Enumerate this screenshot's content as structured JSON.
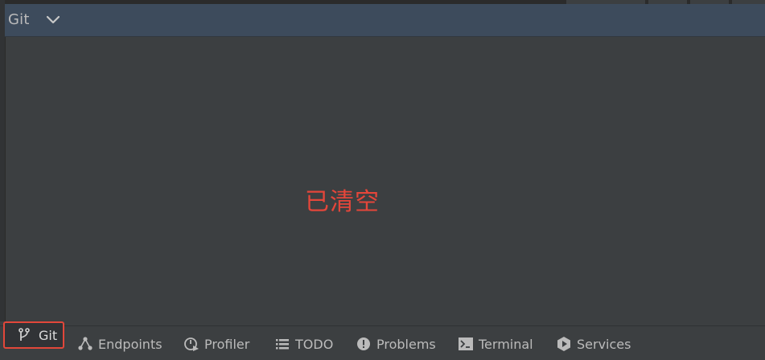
{
  "panel": {
    "title": "Git",
    "message": "已清空"
  },
  "toolwindows": [
    {
      "label": "Git",
      "icon": "git-branch-icon"
    },
    {
      "label": "Endpoints",
      "icon": "endpoints-icon"
    },
    {
      "label": "Profiler",
      "icon": "profiler-icon"
    },
    {
      "label": "TODO",
      "icon": "todo-list-icon"
    },
    {
      "label": "Problems",
      "icon": "problems-icon"
    },
    {
      "label": "Terminal",
      "icon": "terminal-icon"
    },
    {
      "label": "Services",
      "icon": "services-icon"
    }
  ],
  "colors": {
    "background": "#3c3f41",
    "header": "#3d4b5c",
    "highlight_border": "#e2473a",
    "message": "#e5463a",
    "text": "#bbbbbb"
  }
}
